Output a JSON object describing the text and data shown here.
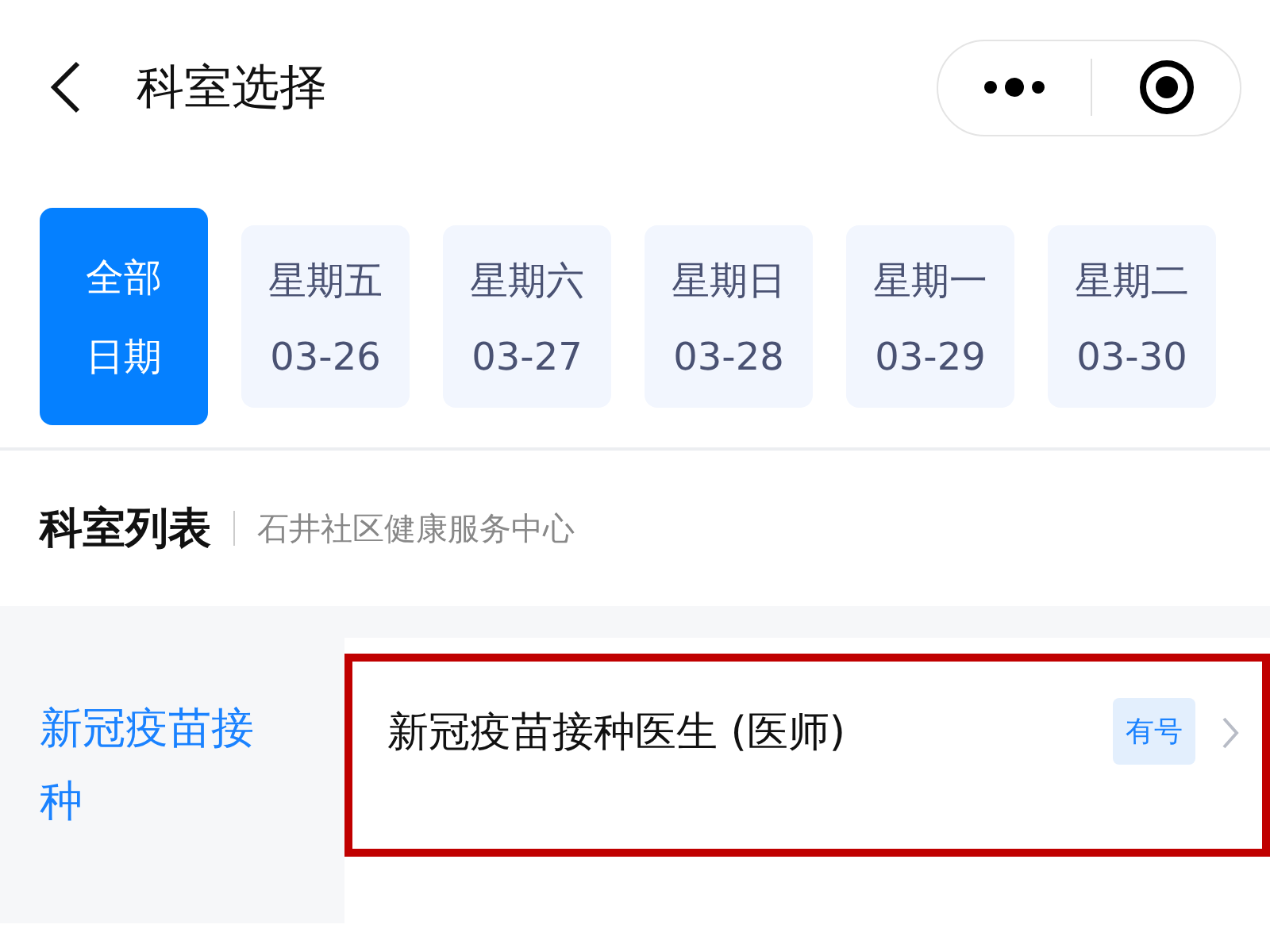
{
  "header": {
    "title": "科室选择"
  },
  "date_tabs": [
    {
      "line1": "全部",
      "line2": "日期",
      "selected": true
    },
    {
      "line1": "星期五",
      "line2": "03-26",
      "selected": false
    },
    {
      "line1": "星期六",
      "line2": "03-27",
      "selected": false
    },
    {
      "line1": "星期日",
      "line2": "03-28",
      "selected": false
    },
    {
      "line1": "星期一",
      "line2": "03-29",
      "selected": false
    },
    {
      "line1": "星期二",
      "line2": "03-30",
      "selected": false
    }
  ],
  "section": {
    "title": "科室列表",
    "subtitle": "石井社区健康服务中心"
  },
  "departments": [
    {
      "name": "新冠疫苗接种",
      "selected": true
    }
  ],
  "doctors": [
    {
      "name": "新冠疫苗接种医生 (医师)",
      "badge": "有号",
      "highlighted": true
    }
  ]
}
